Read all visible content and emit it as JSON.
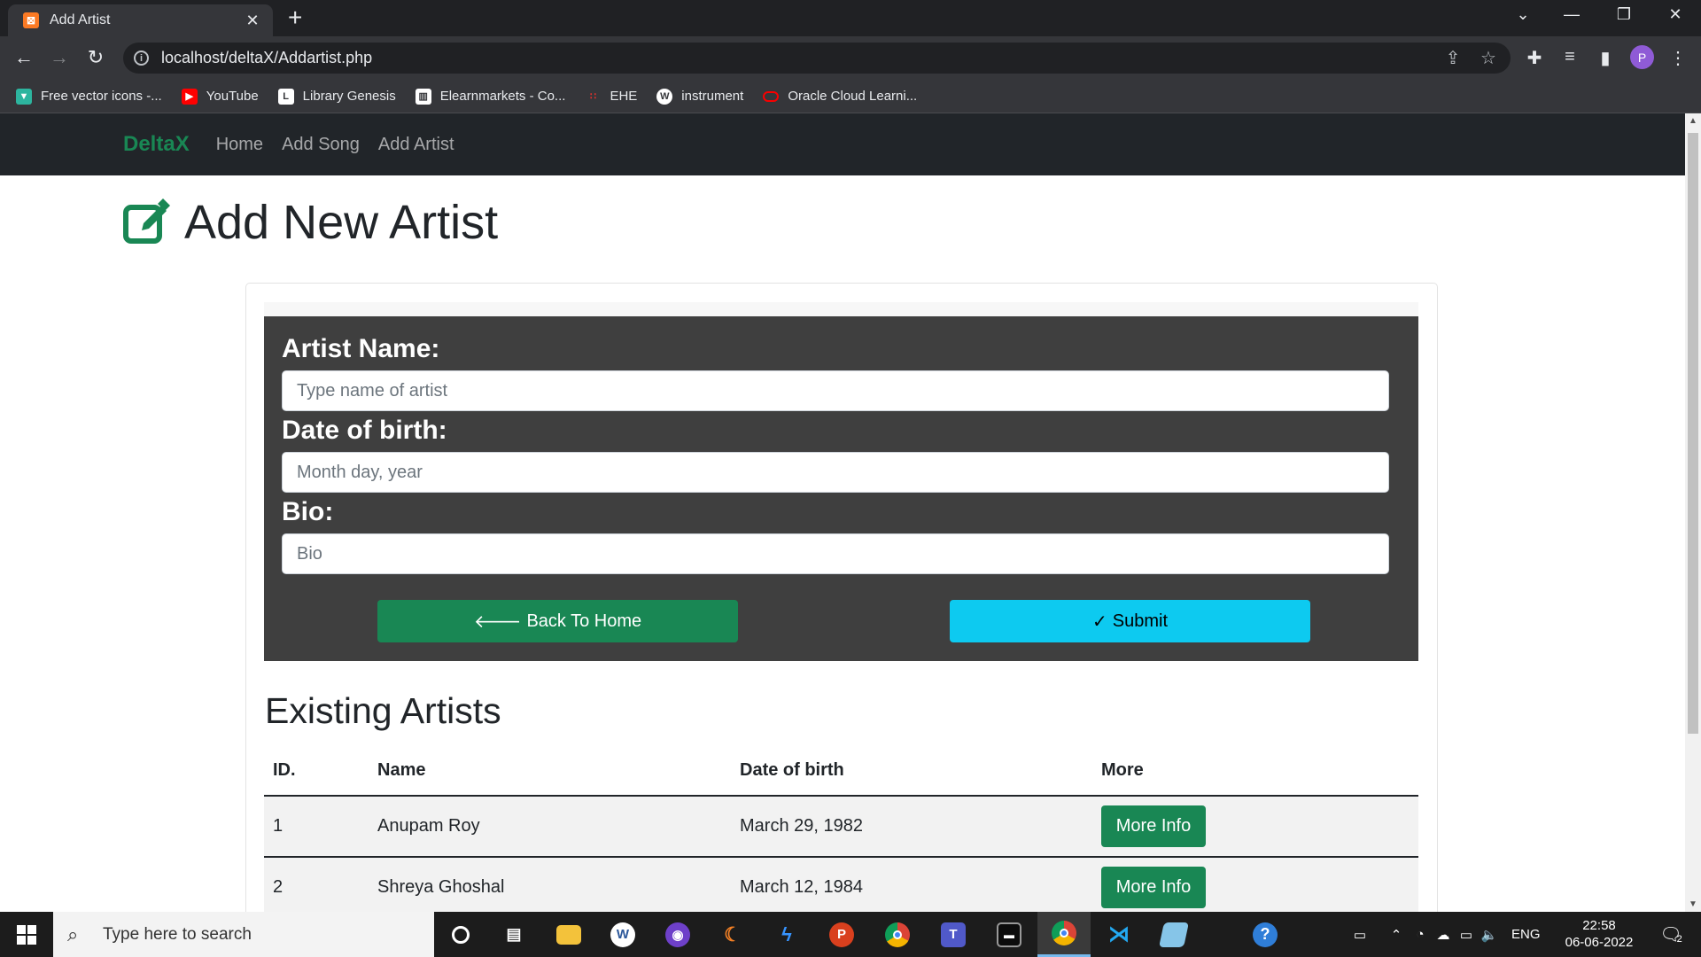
{
  "browser": {
    "tab_title": "Add Artist",
    "tab_favicon": "xampp-icon",
    "url": "localhost/deltaX/Addartist.php",
    "profile_initial": "P",
    "bookmarks": [
      {
        "label": "Free vector icons -...",
        "icon": "flaticon-icon",
        "color": "#2db59f"
      },
      {
        "label": "YouTube",
        "icon": "youtube-icon",
        "color": "#ff0000"
      },
      {
        "label": "Library Genesis",
        "icon": "library-icon",
        "color": "#ffffff"
      },
      {
        "label": "Elearnmarkets - Co...",
        "icon": "chart-icon",
        "color": "#ffffff"
      },
      {
        "label": "EHE",
        "icon": "ehe-icon",
        "color": "#e0312c"
      },
      {
        "label": "instrument",
        "icon": "wordpress-icon",
        "color": "#ffffff"
      },
      {
        "label": "Oracle Cloud Learni...",
        "icon": "oracle-icon",
        "color": "#f80000"
      }
    ]
  },
  "navbar": {
    "brand": "DeltaX",
    "links": [
      "Home",
      "Add Song",
      "Add Artist"
    ]
  },
  "page": {
    "title": "Add New Artist",
    "title_icon": "edit-icon"
  },
  "form": {
    "artist_name_label": "Artist Name:",
    "artist_name_placeholder": "Type name of artist",
    "dob_label": "Date of birth:",
    "dob_placeholder": "Month day, year",
    "bio_label": "Bio:",
    "bio_placeholder": "Bio",
    "back_button": "Back To Home",
    "submit_button": "Submit"
  },
  "artists": {
    "title": "Existing Artists",
    "headers": [
      "ID.",
      "Name",
      "Date of birth",
      "More"
    ],
    "rows": [
      {
        "id": "1",
        "name": "Anupam Roy",
        "dob": "March 29, 1982",
        "more": "More Info"
      },
      {
        "id": "2",
        "name": "Shreya Ghoshal",
        "dob": "March 12, 1984",
        "more": "More Info"
      }
    ]
  },
  "taskbar": {
    "search_placeholder": "Type here to search",
    "apps": [
      "cortana-icon",
      "task-view-icon",
      "file-explorer-icon",
      "office-icon",
      "github-icon",
      "eclipse-icon",
      "visual-studio-icon",
      "pdf-icon",
      "chrome-icon",
      "teams-icon",
      "terminal-icon",
      "chrome-icon",
      "vscode-icon",
      "notepad-icon",
      "help-icon"
    ],
    "language": "ENG",
    "time": "22:58",
    "date": "06-06-2022",
    "notification_count": "2"
  },
  "colors": {
    "brand_green": "#198754",
    "submit_cyan": "#0dcaf0",
    "navbar_dark": "#212529",
    "form_panel": "#3f3f3f"
  }
}
